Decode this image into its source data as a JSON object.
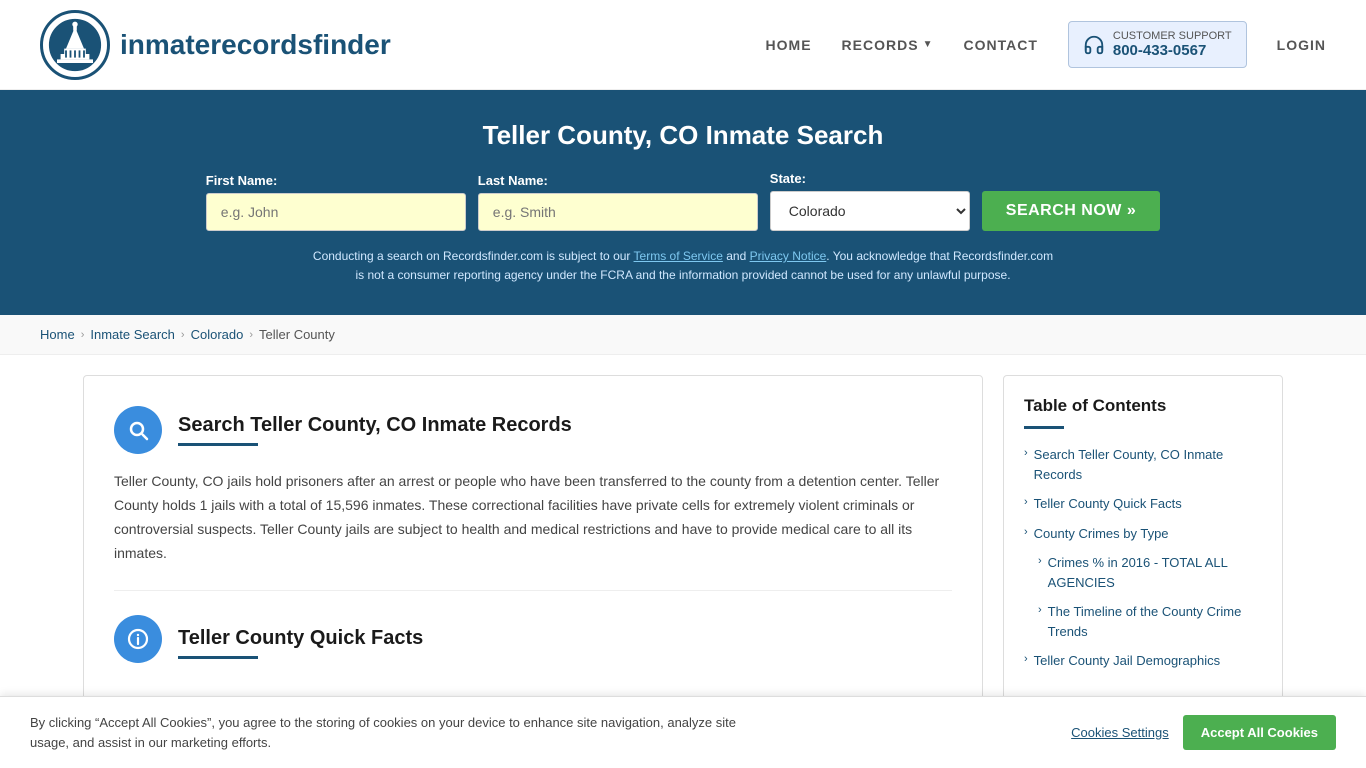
{
  "header": {
    "logo_text_light": "inmaterecords",
    "logo_text_bold": "finder",
    "nav": {
      "home": "HOME",
      "records": "RECORDS",
      "contact": "CONTACT",
      "support_label": "CUSTOMER SUPPORT",
      "support_number": "800-433-0567",
      "login": "LOGIN"
    }
  },
  "hero": {
    "title": "Teller County, CO Inmate Search",
    "form": {
      "first_name_label": "First Name:",
      "first_name_placeholder": "e.g. John",
      "last_name_label": "Last Name:",
      "last_name_placeholder": "e.g. Smith",
      "state_label": "State:",
      "state_value": "Colorado",
      "search_button": "SEARCH NOW »"
    },
    "disclaimer": "Conducting a search on Recordsfinder.com is subject to our Terms of Service and Privacy Notice. You acknowledge that Recordsfinder.com is not a consumer reporting agency under the FCRA and the information provided cannot be used for any unlawful purpose."
  },
  "breadcrumb": {
    "items": [
      "Home",
      "Inmate Search",
      "Colorado",
      "Teller County"
    ]
  },
  "main": {
    "section1": {
      "title": "Search Teller County, CO Inmate Records",
      "body": "Teller County, CO jails hold prisoners after an arrest or people who have been transferred to the county from a detention center. Teller County holds 1 jails with a total of 15,596 inmates. These correctional facilities have private cells for extremely violent criminals or controversial suspects. Teller County jails are subject to health and medical restrictions and have to provide medical care to all its inmates."
    },
    "section2": {
      "title": "Teller County Quick Facts"
    }
  },
  "toc": {
    "title": "Table of Contents",
    "items": [
      {
        "label": "Search Teller County, CO Inmate Records",
        "sub": false
      },
      {
        "label": "Teller County Quick Facts",
        "sub": false
      },
      {
        "label": "County Crimes by Type",
        "sub": false
      },
      {
        "label": "Crimes % in 2016 - TOTAL ALL AGENCIES",
        "sub": true
      },
      {
        "label": "The Timeline of the County Crime Trends",
        "sub": true
      },
      {
        "label": "Teller County Jail Demographics",
        "sub": false
      }
    ]
  },
  "cookie": {
    "text": "By clicking “Accept All Cookies”, you agree to the storing of cookies on your device to enhance site navigation, analyze site usage, and assist in our marketing efforts.",
    "settings_label": "Cookies Settings",
    "accept_label": "Accept All Cookies"
  }
}
